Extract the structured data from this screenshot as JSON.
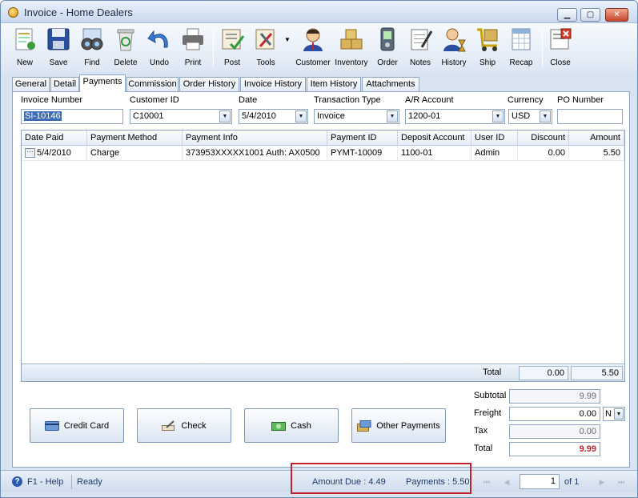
{
  "window": {
    "title": "Invoice - Home Dealers",
    "minimize": "▁",
    "maximize": "▢",
    "close": "✕"
  },
  "toolbar": {
    "new": "New",
    "save": "Save",
    "find": "Find",
    "delete": "Delete",
    "undo": "Undo",
    "print": "Print",
    "post": "Post",
    "tools": "Tools",
    "customer": "Customer",
    "inventory": "Inventory",
    "order": "Order",
    "notes": "Notes",
    "history": "History",
    "ship": "Ship",
    "recap": "Recap",
    "close": "Close"
  },
  "tabs": [
    "General",
    "Detail",
    "Payments",
    "Commission",
    "Order History",
    "Invoice History",
    "Item History",
    "Attachments"
  ],
  "header": {
    "invoice_number_label": "Invoice Number",
    "invoice_number": "SI-10146",
    "customer_id_label": "Customer ID",
    "customer_id": "C10001",
    "date_label": "Date",
    "date": "5/4/2010",
    "transaction_type_label": "Transaction Type",
    "transaction_type": "Invoice",
    "ar_account_label": "A/R Account",
    "ar_account": "1200-01",
    "currency_label": "Currency",
    "currency": "USD",
    "po_number_label": "PO Number",
    "po_number": ""
  },
  "grid": {
    "columns": [
      "Date Paid",
      "Payment Method",
      "Payment Info",
      "Payment ID",
      "Deposit Account",
      "User ID",
      "Discount",
      "Amount"
    ],
    "rows": [
      {
        "date_paid": "5/4/2010",
        "payment_method": "Charge",
        "payment_info": "373953XXXXX1001 Auth: AX0500",
        "payment_id": "PYMT-10009",
        "deposit_account": "1100-01",
        "user_id": "Admin",
        "discount": "0.00",
        "amount": "5.50"
      }
    ],
    "total_label": "Total",
    "total_discount": "0.00",
    "total_amount": "5.50"
  },
  "payment_buttons": {
    "credit_card": "Credit Card",
    "check": "Check",
    "cash": "Cash",
    "other": "Other Payments"
  },
  "summary": {
    "subtotal_label": "Subtotal",
    "subtotal": "9.99",
    "freight_label": "Freight",
    "freight": "0.00",
    "freight_term": "N",
    "tax_label": "Tax",
    "tax": "0.00",
    "total_label": "Total",
    "total": "9.99"
  },
  "status": {
    "help": "F1 - Help",
    "state": "Ready",
    "amount_due": "Amount Due : 4.49",
    "payments": "Payments : 5.50",
    "page": "1",
    "of_pages": "of  1"
  },
  "colors": {
    "accent": "#3d6db4",
    "alert": "#c0212b",
    "total_red": "#c0212b"
  }
}
